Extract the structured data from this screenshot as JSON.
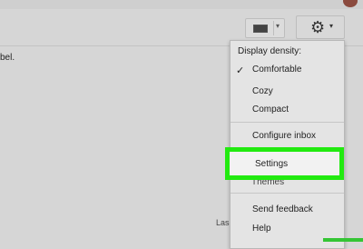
{
  "background_text": {
    "label_fragment": "bel.",
    "footer_fragment": "Las"
  },
  "toolbar": {
    "keyboard_icon": "keyboard-icon",
    "dropdown_caret": "▾",
    "gear_icon_glyph": "⚙",
    "gear_caret": "▾"
  },
  "menu": {
    "header": "Display density:",
    "check_glyph": "✓",
    "items": {
      "comfortable": "Comfortable",
      "cozy": "Cozy",
      "compact": "Compact",
      "configure_inbox": "Configure inbox",
      "settings": "Settings",
      "themes": "Themes",
      "send_feedback": "Send feedback",
      "help": "Help"
    },
    "selected_density": "Comfortable"
  },
  "colors": {
    "highlight": "#22ea10",
    "menu_bg": "#e4e4e4",
    "page_bg": "#d6d6d6"
  }
}
